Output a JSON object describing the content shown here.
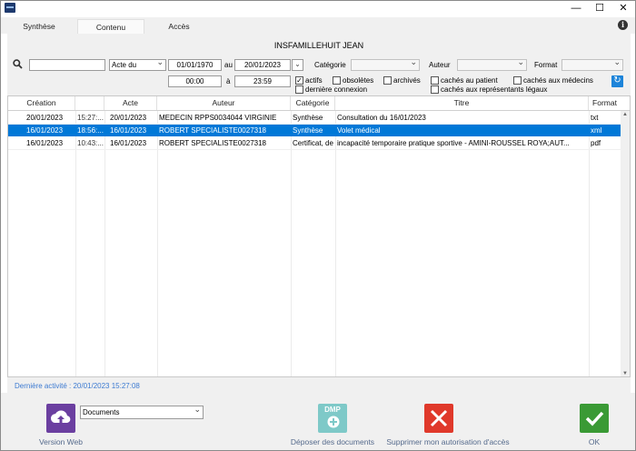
{
  "window": {
    "minimize": "—",
    "maximize": "☐",
    "close": "✕"
  },
  "tabs": [
    {
      "label": "Synthèse"
    },
    {
      "label": "Contenu"
    },
    {
      "label": "Accès"
    }
  ],
  "info_icon": "i",
  "patient_name": "INSFAMILLEHUIT JEAN",
  "filters": {
    "search_icon": "search-icon",
    "search_value": "",
    "date_type": "Acte du",
    "date_from": "01/01/1970",
    "date_to_label": "au",
    "date_to": "20/01/2023",
    "time_from": "00:00",
    "time_to_label": "à",
    "time_to": "23:59",
    "category_label": "Catégorie",
    "category_value": "",
    "author_label": "Auteur",
    "author_value": "",
    "format_label": "Format",
    "format_value": "",
    "checkboxes": {
      "actifs": {
        "label": "actifs",
        "checked": true
      },
      "obsoletes": {
        "label": "obsolètes",
        "checked": false
      },
      "archives": {
        "label": "archivés",
        "checked": false
      },
      "derniere_connexion": {
        "label": "dernière connexion",
        "checked": false
      },
      "caches_patient": {
        "label": "cachés au patient",
        "checked": false
      },
      "caches_medecins": {
        "label": "cachés aux médecins",
        "checked": false
      },
      "caches_representants": {
        "label": "cachés aux représentants légaux",
        "checked": false
      }
    },
    "check_mark": "✓"
  },
  "table": {
    "headers": {
      "creation": "Création",
      "time": "",
      "acte": "Acte",
      "auteur": "Auteur",
      "categorie": "Catégorie",
      "titre": "Titre",
      "format": "Format"
    },
    "rows": [
      {
        "creation": "20/01/2023",
        "time": "15:27:...",
        "acte": "20/01/2023",
        "auteur": "MEDECIN RPPS0034044 VIRGINIE",
        "categorie": "Synthèse",
        "titre": "Consultation du 16/01/2023",
        "format": "txt",
        "selected": false
      },
      {
        "creation": "16/01/2023",
        "time": "18:56:...",
        "acte": "16/01/2023",
        "auteur": "ROBERT SPECIALISTE0027318",
        "categorie": "Synthèse",
        "titre": "Volet médical",
        "format": "xml",
        "selected": true
      },
      {
        "creation": "16/01/2023",
        "time": "10:43:...",
        "acte": "16/01/2023",
        "auteur": "ROBERT SPECIALISTE0027318",
        "categorie": "Certificat, de",
        "titre": "incapacité temporaire pratique sportive - AMINI-ROUSSEL ROYA;AUT...",
        "format": "pdf",
        "selected": false
      }
    ]
  },
  "last_activity": "Dernière activité : 20/01/2023 15:27:08",
  "bottom": {
    "version_web": "Version Web",
    "documents_select": "Documents",
    "dmp_badge": "DMP",
    "deposer": "Déposer des documents",
    "supprimer": "Supprimer mon autorisation d'accès",
    "ok": "OK",
    "colors": {
      "purple": "#6b3fa0",
      "teal": "#7ec9c8",
      "red": "#e0392b",
      "green": "#3a9a35",
      "selection": "#0078d7"
    }
  }
}
